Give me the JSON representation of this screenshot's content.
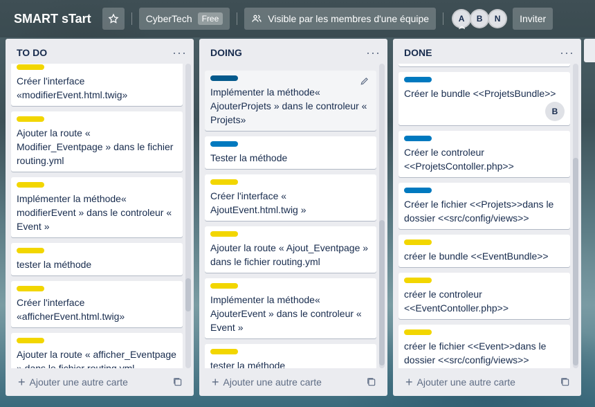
{
  "board": {
    "title": "SMART sTart",
    "workspace": "CyberTech",
    "plan": "Free",
    "visibility": "Visible par les membres d'une équipe",
    "members": [
      "A",
      "B",
      "N"
    ],
    "invite": "Inviter"
  },
  "lists": [
    {
      "title": "TO DO",
      "composer": "Ajouter une autre carte",
      "cards": [
        {
          "label": "yellow",
          "text": "Créer l'interface «modifierEvent.html.twig»"
        },
        {
          "label": "yellow",
          "text": "Ajouter la route « Modifier_Eventpage » dans le fichier routing.yml"
        },
        {
          "label": "yellow",
          "text": "Implémenter la méthode« modifierEvent » dans le controleur « Event »"
        },
        {
          "label": "yellow",
          "text": "tester la méthode"
        },
        {
          "label": "yellow",
          "text": "Créer l'interface «afficherEvent.html.twig»"
        },
        {
          "label": "yellow",
          "text": "Ajouter la route « afficher_Eventpage » dans le fichier routing.yml"
        }
      ]
    },
    {
      "title": "DOING",
      "composer": "Ajouter une autre carte",
      "cards": [
        {
          "label": "darkblue",
          "text": "Implémenter la méthode« AjouterProjets » dans le controleur « Projets»"
        },
        {
          "label": "blue",
          "text": "Tester la méthode"
        },
        {
          "label": "yellow",
          "text": "Créer l'interface « AjoutEvent.html.twig »"
        },
        {
          "label": "yellow",
          "text": "Ajouter la route « Ajout_Eventpage » dans le fichier routing.yml"
        },
        {
          "label": "yellow",
          "text": "Implémenter la méthode« AjouterEvent » dans le controleur « Event »"
        },
        {
          "label": "yellow",
          "text": "tester la méthode"
        }
      ]
    },
    {
      "title": "DONE",
      "composer": "Ajouter une autre carte",
      "cards": [
        {
          "label": "blue",
          "text": "Créer le bundle <<ProjetsBundle>>",
          "member": "B"
        },
        {
          "label": "blue",
          "text": "Créer le controleur <<ProjetsContoller.php>>"
        },
        {
          "label": "blue",
          "text": "Créer le fichier <<Projets>>dans le dossier <<src/config/views>>"
        },
        {
          "label": "yellow",
          "text": "créer le bundle <<EventBundle>>"
        },
        {
          "label": "yellow",
          "text": "créer le controleur <<EventContoller.php>>"
        },
        {
          "label": "yellow",
          "text": "créer le fichier <<Event>>dans le dossier <<src/config/views>>"
        }
      ]
    }
  ]
}
